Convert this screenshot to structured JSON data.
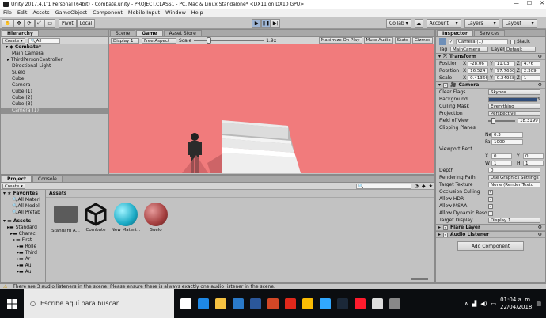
{
  "window": {
    "title": "Unity 2017.4.1f1 Personal (64bit) - Combate.unity - PROJECT.CLASS1 - PC, Mac & Linux Standalone* <DX11 on DX10 GPU>"
  },
  "menu": [
    "File",
    "Edit",
    "Assets",
    "GameObject",
    "Component",
    "Mobile Input",
    "Window",
    "Help"
  ],
  "toolbar": {
    "pivot": "Pivot",
    "local": "Local",
    "collab": "Collab",
    "account": "Account",
    "layers": "Layers",
    "layout": "Layout"
  },
  "hierarchy": {
    "tab": "Hierarchy",
    "create": "Create",
    "search_label": "All",
    "scene": "Combate*",
    "items": [
      "Main Camera",
      "ThirdPersonController",
      "Directional Light",
      "Suelo",
      "Cube",
      "Camera",
      "Cube (1)",
      "Cube (2)",
      "Cube (3)",
      "Camera (1)"
    ],
    "selected_index": 9
  },
  "center": {
    "tabs": [
      "Scene",
      "Game",
      "Asset Store"
    ],
    "active_tab": "Game",
    "display": "Display 1",
    "aspect": "Free Aspect",
    "scale_label": "Scale",
    "scale_value": "1.9x",
    "toggles": [
      "Maximize On Play",
      "Mute Audio",
      "Stats",
      "Gizmos"
    ]
  },
  "inspector": {
    "tabs": [
      "Inspector",
      "Services"
    ],
    "object_name": "Camera (1)",
    "static_label": "Static",
    "tag_label": "Tag",
    "tag": "MainCamera",
    "layer_label": "Layer",
    "layer": "Default",
    "transform": {
      "title": "Transform",
      "position_label": "Position",
      "rotation_label": "Rotation",
      "scale_label": "Scale",
      "position": {
        "x": "-28.06",
        "y": "11.03",
        "z": "4.76"
      },
      "rotation": {
        "x": "16.524",
        "y": "97.7630",
        "z": "2.309"
      },
      "scale": {
        "x": "0.41366",
        "y": "0.24958",
        "z": "1"
      }
    },
    "camera": {
      "title": "Camera",
      "rows": [
        {
          "label": "Clear Flags",
          "value": "Skybox"
        },
        {
          "label": "Background",
          "value": ""
        },
        {
          "label": "Culling Mask",
          "value": "Everything"
        },
        {
          "label": "Projection",
          "value": "Perspective"
        },
        {
          "label": "Field of View",
          "value": "18.3199"
        },
        {
          "label": "Clipping Planes",
          "value": ""
        },
        {
          "label": "Near",
          "value": "0.3"
        },
        {
          "label": "Far",
          "value": "1000"
        },
        {
          "label": "Viewport Rect",
          "value": ""
        },
        {
          "label": "X",
          "value": "0"
        },
        {
          "label": "Y",
          "value": "0"
        },
        {
          "label": "W",
          "value": "1"
        },
        {
          "label": "H",
          "value": "1"
        },
        {
          "label": "Depth",
          "value": "0"
        },
        {
          "label": "Rendering Path",
          "value": "Use Graphics Settings"
        },
        {
          "label": "Target Texture",
          "value": "None (Render Textu"
        },
        {
          "label": "Occlusion Culling",
          "value": true
        },
        {
          "label": "Allow HDR",
          "value": true
        },
        {
          "label": "Allow MSAA",
          "value": true
        },
        {
          "label": "Allow Dynamic Reso",
          "value": false
        },
        {
          "label": "Target Display",
          "value": "Display 1"
        }
      ]
    },
    "flare_layer": "Flare Layer",
    "audio_listener": "Audio Listener",
    "add_component": "Add Component"
  },
  "project": {
    "tabs": [
      "Project",
      "Console"
    ],
    "create": "Create",
    "favorites_title": "Favorites",
    "favorites": [
      "All Materi",
      "All Model",
      "All Prefab"
    ],
    "assets_title": "Assets",
    "tree": [
      "Standard",
      "Charac",
      "First",
      "Rolle",
      "Third",
      "Ar",
      "Au",
      "Au"
    ],
    "breadcrumb": "Assets",
    "assets": [
      {
        "name": "Standard A...",
        "kind": "folder"
      },
      {
        "name": "Combate",
        "kind": "unity"
      },
      {
        "name": "New Materi...",
        "kind": "material-cyan"
      },
      {
        "name": "Suelo",
        "kind": "material-red"
      }
    ]
  },
  "status": {
    "message": "There are 3 audio listeners in the scene. Please ensure there is always exactly one audio listener in the scene."
  },
  "taskbar": {
    "search_placeholder": "Escribe aquí para buscar",
    "time": "01:04 a. m.",
    "date": "22/04/2018",
    "apps": [
      {
        "name": "task-view",
        "color": "#ffffff"
      },
      {
        "name": "edge",
        "color": "#1e88e5"
      },
      {
        "name": "file-explorer",
        "color": "#f5c242"
      },
      {
        "name": "store",
        "color": "#2a7ac9"
      },
      {
        "name": "word",
        "color": "#2b579a"
      },
      {
        "name": "powerpoint",
        "color": "#d24726"
      },
      {
        "name": "acrobat",
        "color": "#e0281b"
      },
      {
        "name": "chrome",
        "color": "#fbbc04"
      },
      {
        "name": "photoshop",
        "color": "#31a8ff"
      },
      {
        "name": "steam",
        "color": "#1b2838"
      },
      {
        "name": "opera",
        "color": "#ff1b2d"
      },
      {
        "name": "unity",
        "color": "#dddddd"
      },
      {
        "name": "unity-hub",
        "color": "#888888"
      }
    ]
  },
  "colors": {
    "scene_bg": "#f17b7c",
    "selection": "#9fb6d6",
    "inspector_bg": "#c2c2c2"
  }
}
